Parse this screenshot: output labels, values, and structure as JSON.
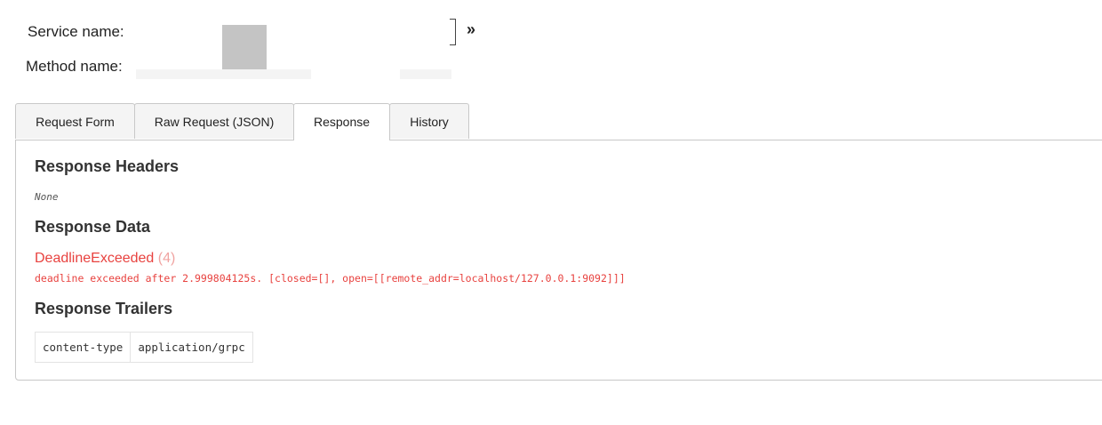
{
  "form": {
    "service_label": "Service name:",
    "method_label": "Method name:",
    "expand_glyph": "»"
  },
  "tabs": [
    {
      "label": "Request Form",
      "active": false
    },
    {
      "label": "Raw Request (JSON)",
      "active": false
    },
    {
      "label": "Response",
      "active": true
    },
    {
      "label": "History",
      "active": false
    }
  ],
  "response": {
    "headers_title": "Response Headers",
    "headers_value": "None",
    "data_title": "Response Data",
    "error_name": "DeadlineExceeded",
    "error_code": "(4)",
    "error_message": "deadline exceeded after 2.999804125s. [closed=[], open=[[remote_addr=localhost/127.0.0.1:9092]]]",
    "trailers_title": "Response Trailers",
    "trailers": [
      {
        "key": "content-type",
        "value": "application/grpc"
      }
    ]
  },
  "colors": {
    "error": "#e8423f",
    "error_code": "#f0a3a1",
    "border": "#c8c8c8",
    "tab_bg": "#f4f4f4"
  }
}
